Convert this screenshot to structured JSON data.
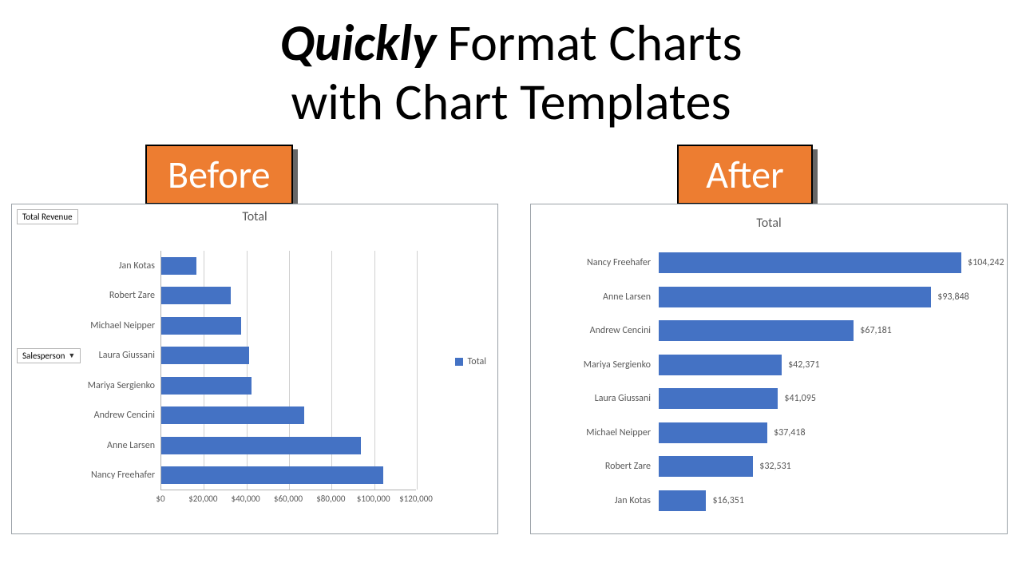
{
  "headline": {
    "emph": "Quickly",
    "line1_rest": " Format Charts",
    "line2": "with Chart Templates"
  },
  "badges": {
    "before": "Before",
    "after": "After"
  },
  "before": {
    "pivot_revenue": "Total Revenue",
    "pivot_salesperson": "Salesperson",
    "title": "Total",
    "legend": "Total",
    "xticks": [
      "$0",
      "$20,000",
      "$40,000",
      "$60,000",
      "$80,000",
      "$100,000",
      "$120,000"
    ]
  },
  "after": {
    "title": "Total"
  },
  "chart_data": [
    {
      "id": "before",
      "type": "bar",
      "orientation": "horizontal",
      "title": "Total",
      "xlabel": "",
      "ylabel": "",
      "xlim": [
        0,
        120000
      ],
      "legend": [
        "Total"
      ],
      "categories": [
        "Jan Kotas",
        "Robert Zare",
        "Michael Neipper",
        "Laura Giussani",
        "Mariya Sergienko",
        "Andrew Cencini",
        "Anne Larsen",
        "Nancy Freehafer"
      ],
      "values": [
        16351,
        32531,
        37418,
        41095,
        42371,
        67181,
        93848,
        104242
      ]
    },
    {
      "id": "after",
      "type": "bar",
      "orientation": "horizontal",
      "title": "Total",
      "categories": [
        "Nancy Freehafer",
        "Anne Larsen",
        "Andrew Cencini",
        "Mariya Sergienko",
        "Laura Giussani",
        "Michael Neipper",
        "Robert Zare",
        "Jan Kotas"
      ],
      "values": [
        104242,
        93848,
        67181,
        42371,
        41095,
        37418,
        32531,
        16351
      ],
      "value_labels": [
        "$104,242",
        "$93,848",
        "$67,181",
        "$42,371",
        "$41,095",
        "$37,418",
        "$32,531",
        "$16,351"
      ],
      "xlim": [
        0,
        110000
      ]
    }
  ]
}
